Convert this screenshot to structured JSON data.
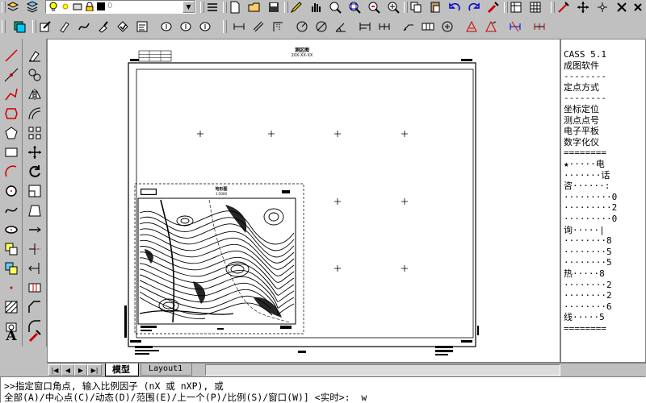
{
  "toolbar_top": {
    "color_swatch": "#000000",
    "layer_dropdown_value": "0"
  },
  "side_panel": {
    "lines": [
      "CASS 5.1",
      "成图软件",
      "--------",
      "定点方式",
      "--------",
      "坐标定位",
      "测点点号",
      "电子平板",
      "数字化仪",
      "========",
      "★·····电",
      "·······话",
      "咨······:",
      "·········0",
      "·········2",
      "·········0",
      "询·····|",
      "········8",
      "········5",
      "········5",
      "热·····8",
      "········2",
      "········2",
      "········6",
      "线·····5",
      "========"
    ]
  },
  "drawing": {
    "sheet_title": "测区图",
    "sheet_subtitle": "20X·XX·XX",
    "map_title": "地形图",
    "map_subtitle": "1:5000"
  },
  "tabs": {
    "model": "模型",
    "layout1": "Layout1"
  },
  "command": {
    "line1": ">>指定窗口角点, 输入比例因子 (nX 或 nXP), 或",
    "line2": "全部(A)/中心点(C)/动态(D)/范围(E)/上一个(P)/比例(S)/窗口(W)] <实时>:  w"
  },
  "colors": {
    "ui_gray": "#c0c0c0",
    "canvas": "#ffffff",
    "accent_red": "#cc0000",
    "accent_blue": "#0000cc"
  }
}
